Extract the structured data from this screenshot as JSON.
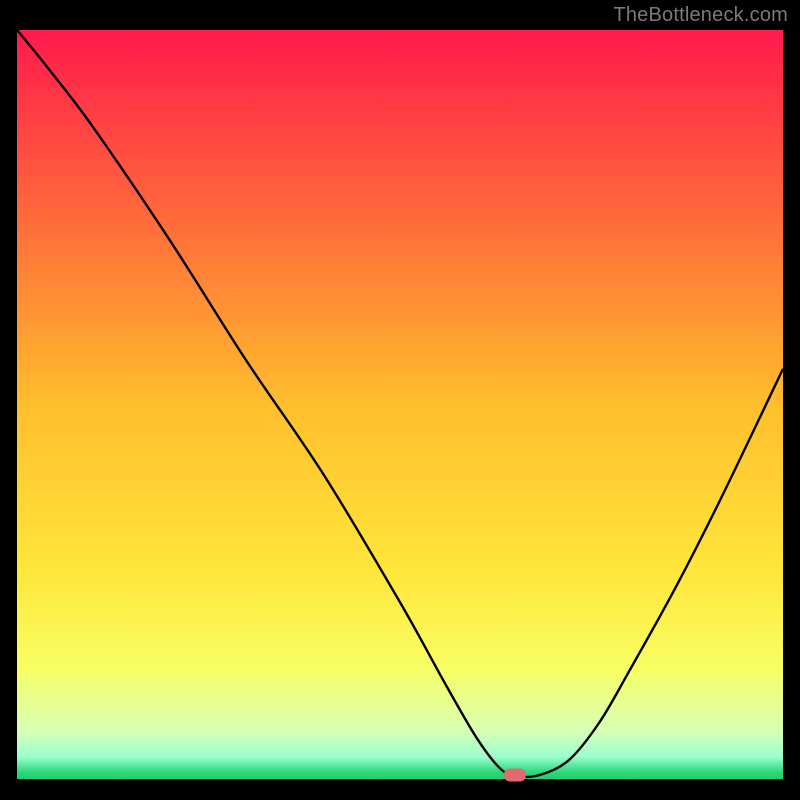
{
  "attribution": "TheBottleneck.com",
  "chart_data": {
    "type": "line",
    "title": "",
    "xlabel": "",
    "ylabel": "",
    "xlim": [
      0,
      100
    ],
    "ylim": [
      0,
      100
    ],
    "x": [
      0,
      4,
      10,
      20,
      30,
      40,
      50,
      56,
      60,
      63,
      65,
      68,
      72,
      76,
      80,
      86,
      92,
      100
    ],
    "values": [
      100,
      95,
      87,
      72,
      56,
      41,
      24,
      13,
      6,
      2,
      1,
      1,
      3,
      8,
      15,
      26,
      38,
      55
    ],
    "marker": {
      "x": 65,
      "y": 1
    },
    "background_gradient": {
      "stops": [
        {
          "offset": 0.0,
          "color": "#ff1a4b"
        },
        {
          "offset": 0.25,
          "color": "#ff6a3a"
        },
        {
          "offset": 0.5,
          "color": "#ffbf2d"
        },
        {
          "offset": 0.72,
          "color": "#ffe63a"
        },
        {
          "offset": 0.85,
          "color": "#f8ff66"
        },
        {
          "offset": 0.93,
          "color": "#d8ffb3"
        },
        {
          "offset": 0.965,
          "color": "#9bffd0"
        },
        {
          "offset": 0.985,
          "color": "#2fd97d"
        },
        {
          "offset": 1.0,
          "color": "#17c76b"
        }
      ]
    },
    "marker_color": "#e06a6f",
    "axis_color": "#000000",
    "curve_color": "#000000"
  }
}
